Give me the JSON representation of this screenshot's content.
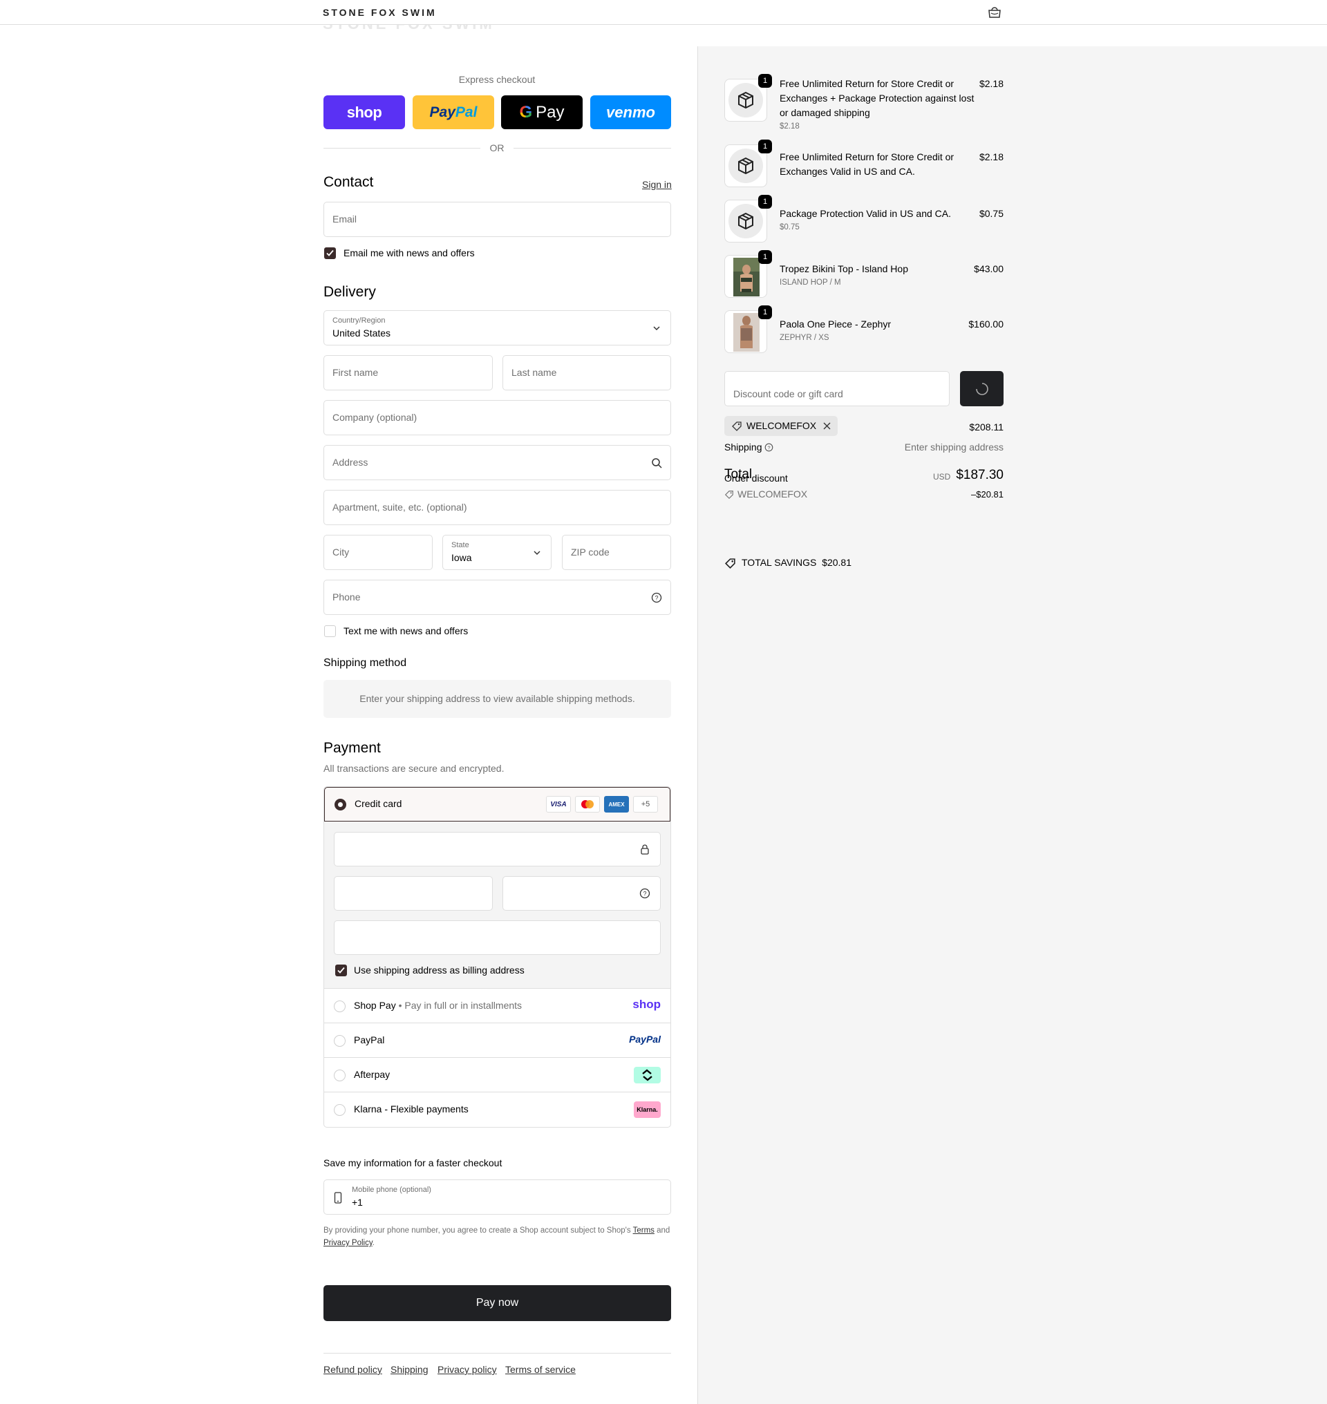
{
  "header": {
    "brand": "STONE FOX SWIM"
  },
  "express": {
    "label": "Express checkout",
    "shop": "shop",
    "paypal_a": "Pay",
    "paypal_b": "Pal",
    "gpay": "Pay",
    "venmo": "venmo",
    "or": "OR"
  },
  "contact": {
    "title": "Contact",
    "signin": "Sign in",
    "email_placeholder": "Email",
    "newsletter": "Email me with news and offers"
  },
  "delivery": {
    "title": "Delivery",
    "country_label": "Country/Region",
    "country_value": "United States",
    "first_name": "First name",
    "last_name": "Last name",
    "company": "Company (optional)",
    "address": "Address",
    "apartment": "Apartment, suite, etc. (optional)",
    "city": "City",
    "state_label": "State",
    "state_value": "Iowa",
    "zip": "ZIP code",
    "phone": "Phone",
    "sms": "Text me with news and offers"
  },
  "shipping_method": {
    "title": "Shipping method",
    "message": "Enter your shipping address to view available shipping methods."
  },
  "payment": {
    "title": "Payment",
    "subtitle": "All transactions are secure and encrypted.",
    "credit_card": "Credit card",
    "cards": [
      "VISA",
      "AMEX",
      "+5"
    ],
    "billing_same": "Use shipping address as billing address",
    "shop_pay": "Shop Pay",
    "shop_pay_sub": "Pay in full or in installments",
    "shop_pay_logo": "shop",
    "paypal": "PayPal",
    "paypal_logo": "PayPal",
    "afterpay": "Afterpay",
    "klarna": "Klarna - Flexible payments",
    "klarna_logo": "Klarna."
  },
  "save_info": {
    "title": "Save my information for a faster checkout",
    "mobile_label": "Mobile phone (optional)",
    "mobile_value": "+1",
    "legal_a": "By providing your phone number, you agree to create a Shop account subject to Shop's ",
    "legal_terms": "Terms",
    "legal_b": " and ",
    "legal_privacy": "Privacy Policy",
    "legal_c": "."
  },
  "pay_now": "Pay now",
  "footer": [
    "Refund policy",
    "Shipping",
    "Privacy policy",
    "Terms of service"
  ],
  "summary": {
    "items": [
      {
        "qty": "1",
        "name": "Free Unlimited Return for Store Credit or Exchanges + Package Protection against lost or damaged shipping",
        "sub": "$2.18",
        "price": "$2.18"
      },
      {
        "qty": "1",
        "name": "Free Unlimited Return for Store Credit or Exchanges Valid in US and CA.",
        "sub": "",
        "price": "$2.18"
      },
      {
        "qty": "1",
        "name": "Package Protection Valid in US and CA.",
        "sub": "$0.75",
        "price": "$0.75"
      },
      {
        "qty": "1",
        "name": "Tropez Bikini Top - Island Hop",
        "sub": "ISLAND HOP / M",
        "price": "$43.00"
      },
      {
        "qty": "1",
        "name": "Paola One Piece - Zephyr",
        "sub": "ZEPHYR / XS",
        "price": "$160.00"
      }
    ],
    "discount_placeholder": "Discount code or gift card",
    "code": "WELCOMEFOX",
    "subtotal": "$208.11",
    "shipping_label": "Shipping",
    "shipping_value": "Enter shipping address",
    "total_label": "Total",
    "order_discount": "Order discount",
    "currency": "USD",
    "total": "$187.30",
    "discount_code": "WELCOMEFOX",
    "discount_amount": "–$20.81",
    "savings_label": "TOTAL SAVINGS",
    "savings_value": "$20.81"
  }
}
